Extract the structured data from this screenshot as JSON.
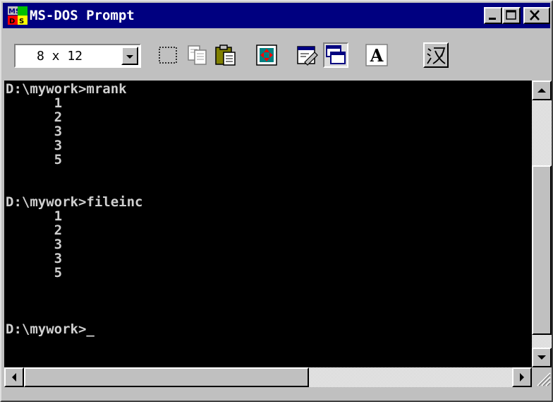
{
  "window": {
    "title": "MS-DOS Prompt",
    "icon": "ms-dos-icon",
    "caption_buttons": [
      "minimize-icon",
      "maximize-icon",
      "close-icon"
    ]
  },
  "toolbar": {
    "font_size_value": "8 x 12",
    "buttons": [
      {
        "name": "mark",
        "icon": "mark-icon"
      },
      {
        "name": "copy",
        "icon": "copy-icon"
      },
      {
        "name": "paste",
        "icon": "paste-icon"
      },
      {
        "name": "full-screen",
        "icon": "full-screen-icon"
      },
      {
        "name": "properties",
        "icon": "properties-icon"
      },
      {
        "name": "background",
        "icon": "background-icon"
      },
      {
        "name": "font",
        "icon": "font-icon",
        "label": "A"
      },
      {
        "name": "input-method",
        "icon": "input-method-icon",
        "label": "汉"
      }
    ]
  },
  "console": {
    "lines": [
      "D:\\mywork>mrank",
      "      1",
      "      2",
      "      3",
      "      3",
      "      5",
      "",
      "",
      "D:\\mywork>fileinc",
      "      1",
      "      2",
      "      3",
      "      3",
      "      5",
      "",
      "",
      "",
      "D:\\mywork>_"
    ]
  },
  "colors": {
    "titlebar": "#000080",
    "console_bg": "#000000",
    "console_text": "#d0d0d0",
    "chrome": "#c0c0c0"
  }
}
